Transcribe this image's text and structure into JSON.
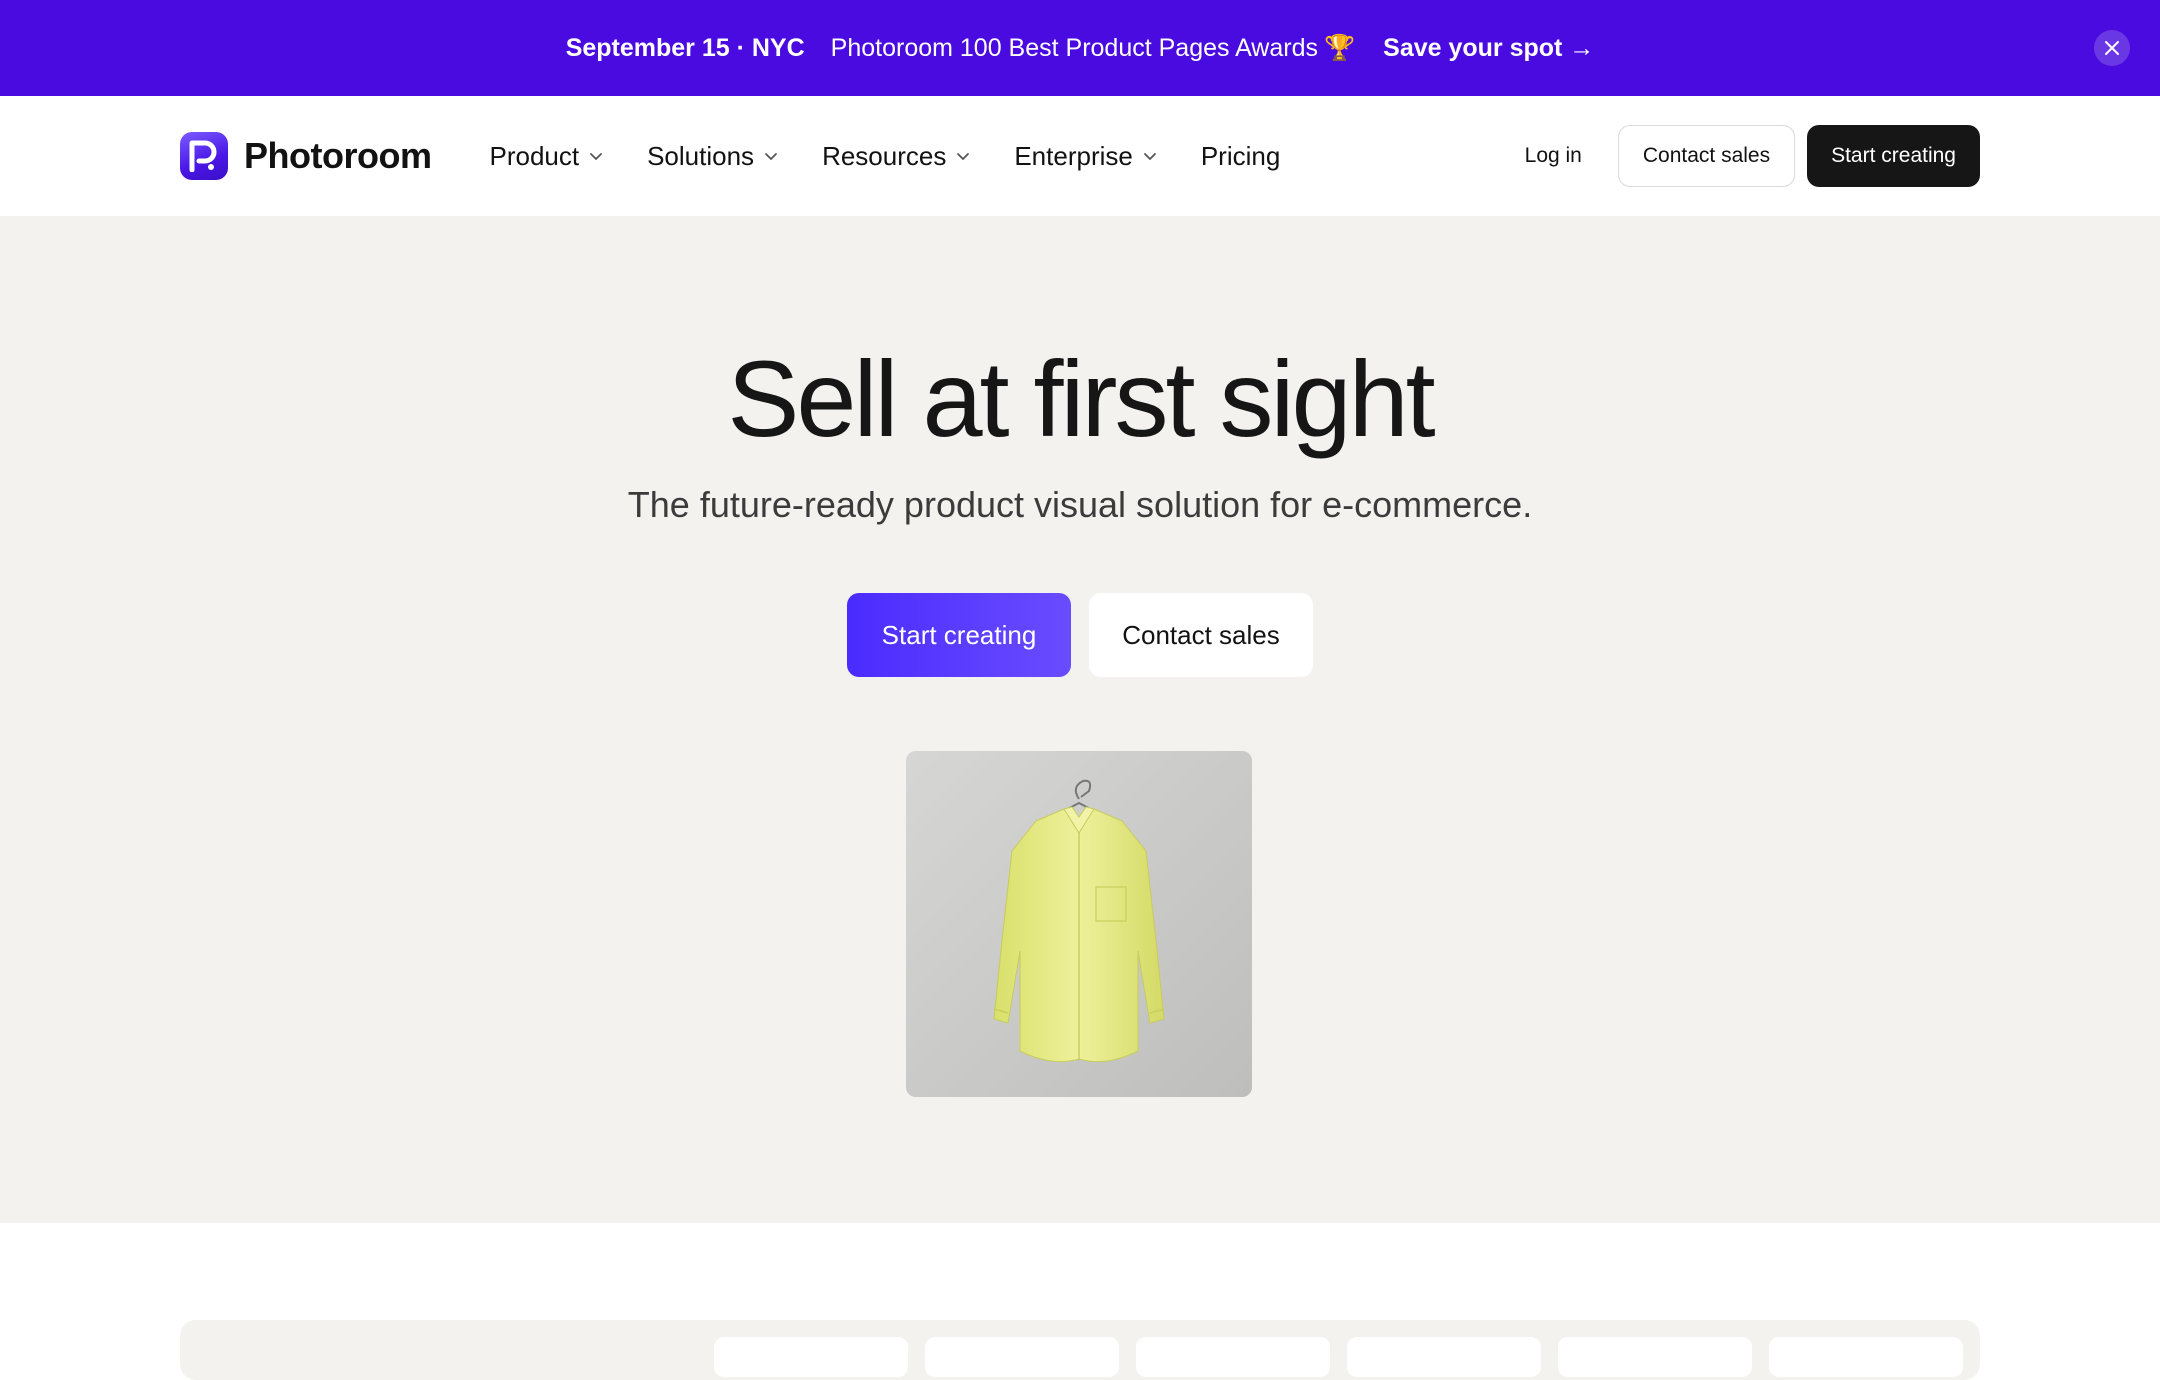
{
  "banner": {
    "event": "September 15 · NYC",
    "title": "Photoroom 100 Best Product Pages Awards",
    "trophy": "🏆",
    "cta": "Save your spot →",
    "close_icon": "close-icon"
  },
  "nav": {
    "brand": "Photoroom",
    "menu": [
      {
        "label": "Product",
        "has_dropdown": true
      },
      {
        "label": "Solutions",
        "has_dropdown": true
      },
      {
        "label": "Resources",
        "has_dropdown": true
      },
      {
        "label": "Enterprise",
        "has_dropdown": true
      },
      {
        "label": "Pricing",
        "has_dropdown": false
      }
    ],
    "login": "Log in",
    "contact_sales": "Contact sales",
    "start_creating": "Start creating"
  },
  "hero": {
    "title": "Sell at first sight",
    "subtitle": "The future-ready product visual solution for e-commerce.",
    "primary_cta": "Start creating",
    "secondary_cta": "Contact sales"
  },
  "colors": {
    "banner_bg": "#4a0be0",
    "accent": "#4a2bff",
    "hero_bg": "#f3f2ef",
    "dark_button": "#161616"
  }
}
